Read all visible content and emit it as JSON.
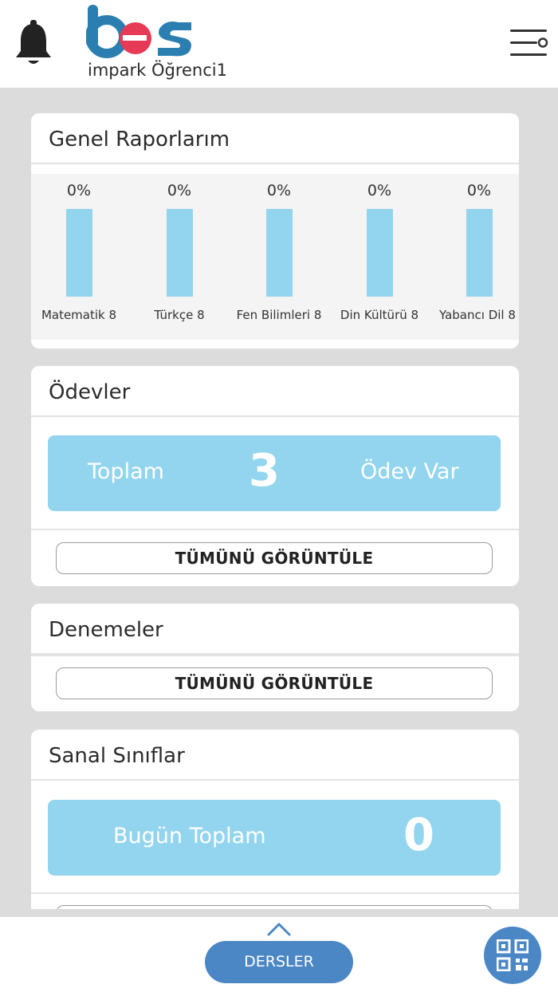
{
  "header": {
    "app_name": "impark Öğrenci1",
    "logo_icon": "bes-logo",
    "notification_icon": "bell-icon",
    "menu_icon": "menu-icon"
  },
  "colors": {
    "bar": "#93d5ee",
    "panel": "#93d5ee",
    "primary": "#4a87c4",
    "logo_blue": "#2a7fb0",
    "logo_red": "#e63a57"
  },
  "reports": {
    "title": "Genel Raporlarım",
    "bars": [
      {
        "label": "Matematik 8",
        "percent": "0%"
      },
      {
        "label": "Türkçe 8",
        "percent": "0%"
      },
      {
        "label": "Fen Bilimleri 8",
        "percent": "0%"
      },
      {
        "label": "Din Kültürü 8",
        "percent": "0%"
      },
      {
        "label": "Yabancı Dil 8",
        "percent": "0%"
      }
    ]
  },
  "homework": {
    "title": "Ödevler",
    "left_text": "Toplam",
    "count": "3",
    "right_text": "Ödev Var",
    "view_all": "TÜMÜNÜ GÖRÜNTÜLE"
  },
  "exams": {
    "title": "Denemeler",
    "view_all": "TÜMÜNÜ GÖRÜNTÜLE"
  },
  "virtual_classes": {
    "title": "Sanal Sınıflar",
    "left_text": "Bugün Toplam",
    "count": "0"
  },
  "footer": {
    "courses_label": "DERSLER",
    "expand_icon": "chevron-up-icon",
    "qr_icon": "qr-code-icon"
  }
}
